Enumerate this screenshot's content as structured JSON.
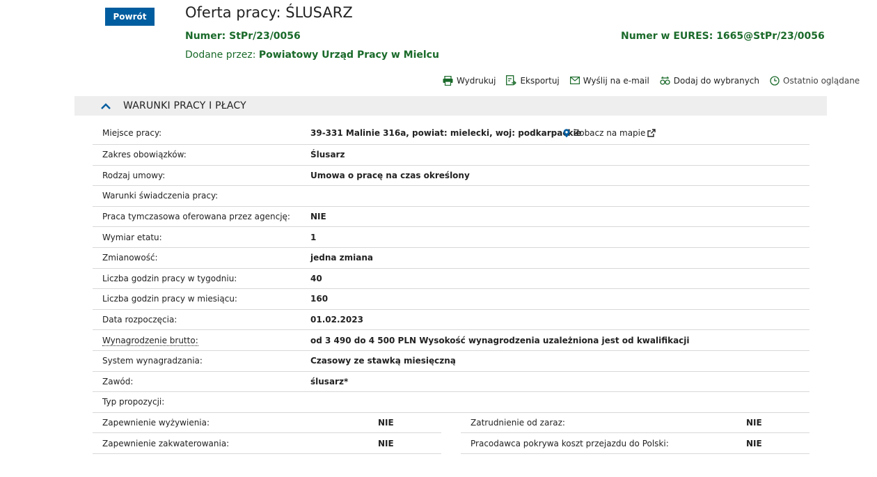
{
  "header": {
    "back_label": "Powrót",
    "title": "Oferta pracy: ŚLUSARZ",
    "number_label": "Numer:",
    "number_value": "StPr/23/0056",
    "eures_label": "Numer w EURES:",
    "eures_value": "1665@StPr/23/0056",
    "added_label": "Dodane przez:",
    "added_value": "Powiatowy Urząd Pracy w Mielcu"
  },
  "actions": [
    {
      "label": "Wydrukuj",
      "icon": "printer-icon"
    },
    {
      "label": "Eksportuj",
      "icon": "export-icon"
    },
    {
      "label": "Wyślij na e-mail",
      "icon": "envelope-icon"
    },
    {
      "label": "Dodaj do wybranych",
      "icon": "favorites-icon"
    },
    {
      "label": "Ostatnio oglądane",
      "icon": "clock-icon"
    }
  ],
  "section": {
    "title": "WARUNKI PRACY I PŁACY",
    "icon": "chevron-up-icon"
  },
  "map_link": "Zobacz na mapie",
  "rows": [
    {
      "label": "Miejsce pracy:",
      "value": "39-331 Malinie 316a, powiat: mielecki, woj: podkarpackie"
    },
    {
      "label": "Zakres obowiązków:",
      "value": "Ślusarz"
    },
    {
      "label": "Rodzaj umowy:",
      "value": "Umowa o pracę na czas określony"
    },
    {
      "label": "Warunki świadczenia pracy:",
      "value": ""
    },
    {
      "label": "Praca tymczasowa oferowana przez agencję:",
      "value": "NIE"
    },
    {
      "label": "Wymiar etatu:",
      "value": "1"
    },
    {
      "label": "Zmianowość:",
      "value": "jedna zmiana"
    },
    {
      "label": "Liczba godzin pracy w tygodniu:",
      "value": "40"
    },
    {
      "label": "Liczba godzin pracy w miesiącu:",
      "value": "160"
    },
    {
      "label": "Data rozpoczęcia:",
      "value": "01.02.2023"
    },
    {
      "label": "Wynagrodzenie brutto:",
      "value": "od 3 490 do 4 500 PLN Wysokość wynagrodzenia uzależniona jest od kwalifikacji"
    },
    {
      "label": "System wynagradzania:",
      "value": "Czasowy ze stawką miesięczną"
    },
    {
      "label": "Zawód:",
      "value": "ślusarz*"
    },
    {
      "label": "Typ propozycji:",
      "value": ""
    }
  ],
  "split_rows": [
    {
      "left_label": "Zapewnienie wyżywienia:",
      "left_value": "NIE",
      "right_label": "Zatrudnienie od zaraz:",
      "right_value": "NIE"
    },
    {
      "left_label": "Zapewnienie zakwaterowania:",
      "left_value": "NIE",
      "right_label": "Pracodawca pokrywa koszt przejazdu do Polski:",
      "right_value": "NIE"
    }
  ],
  "colors": {
    "primary_button": "#005d9f",
    "green_text": "#1a6a2a",
    "section_bg": "#eeeeee"
  }
}
